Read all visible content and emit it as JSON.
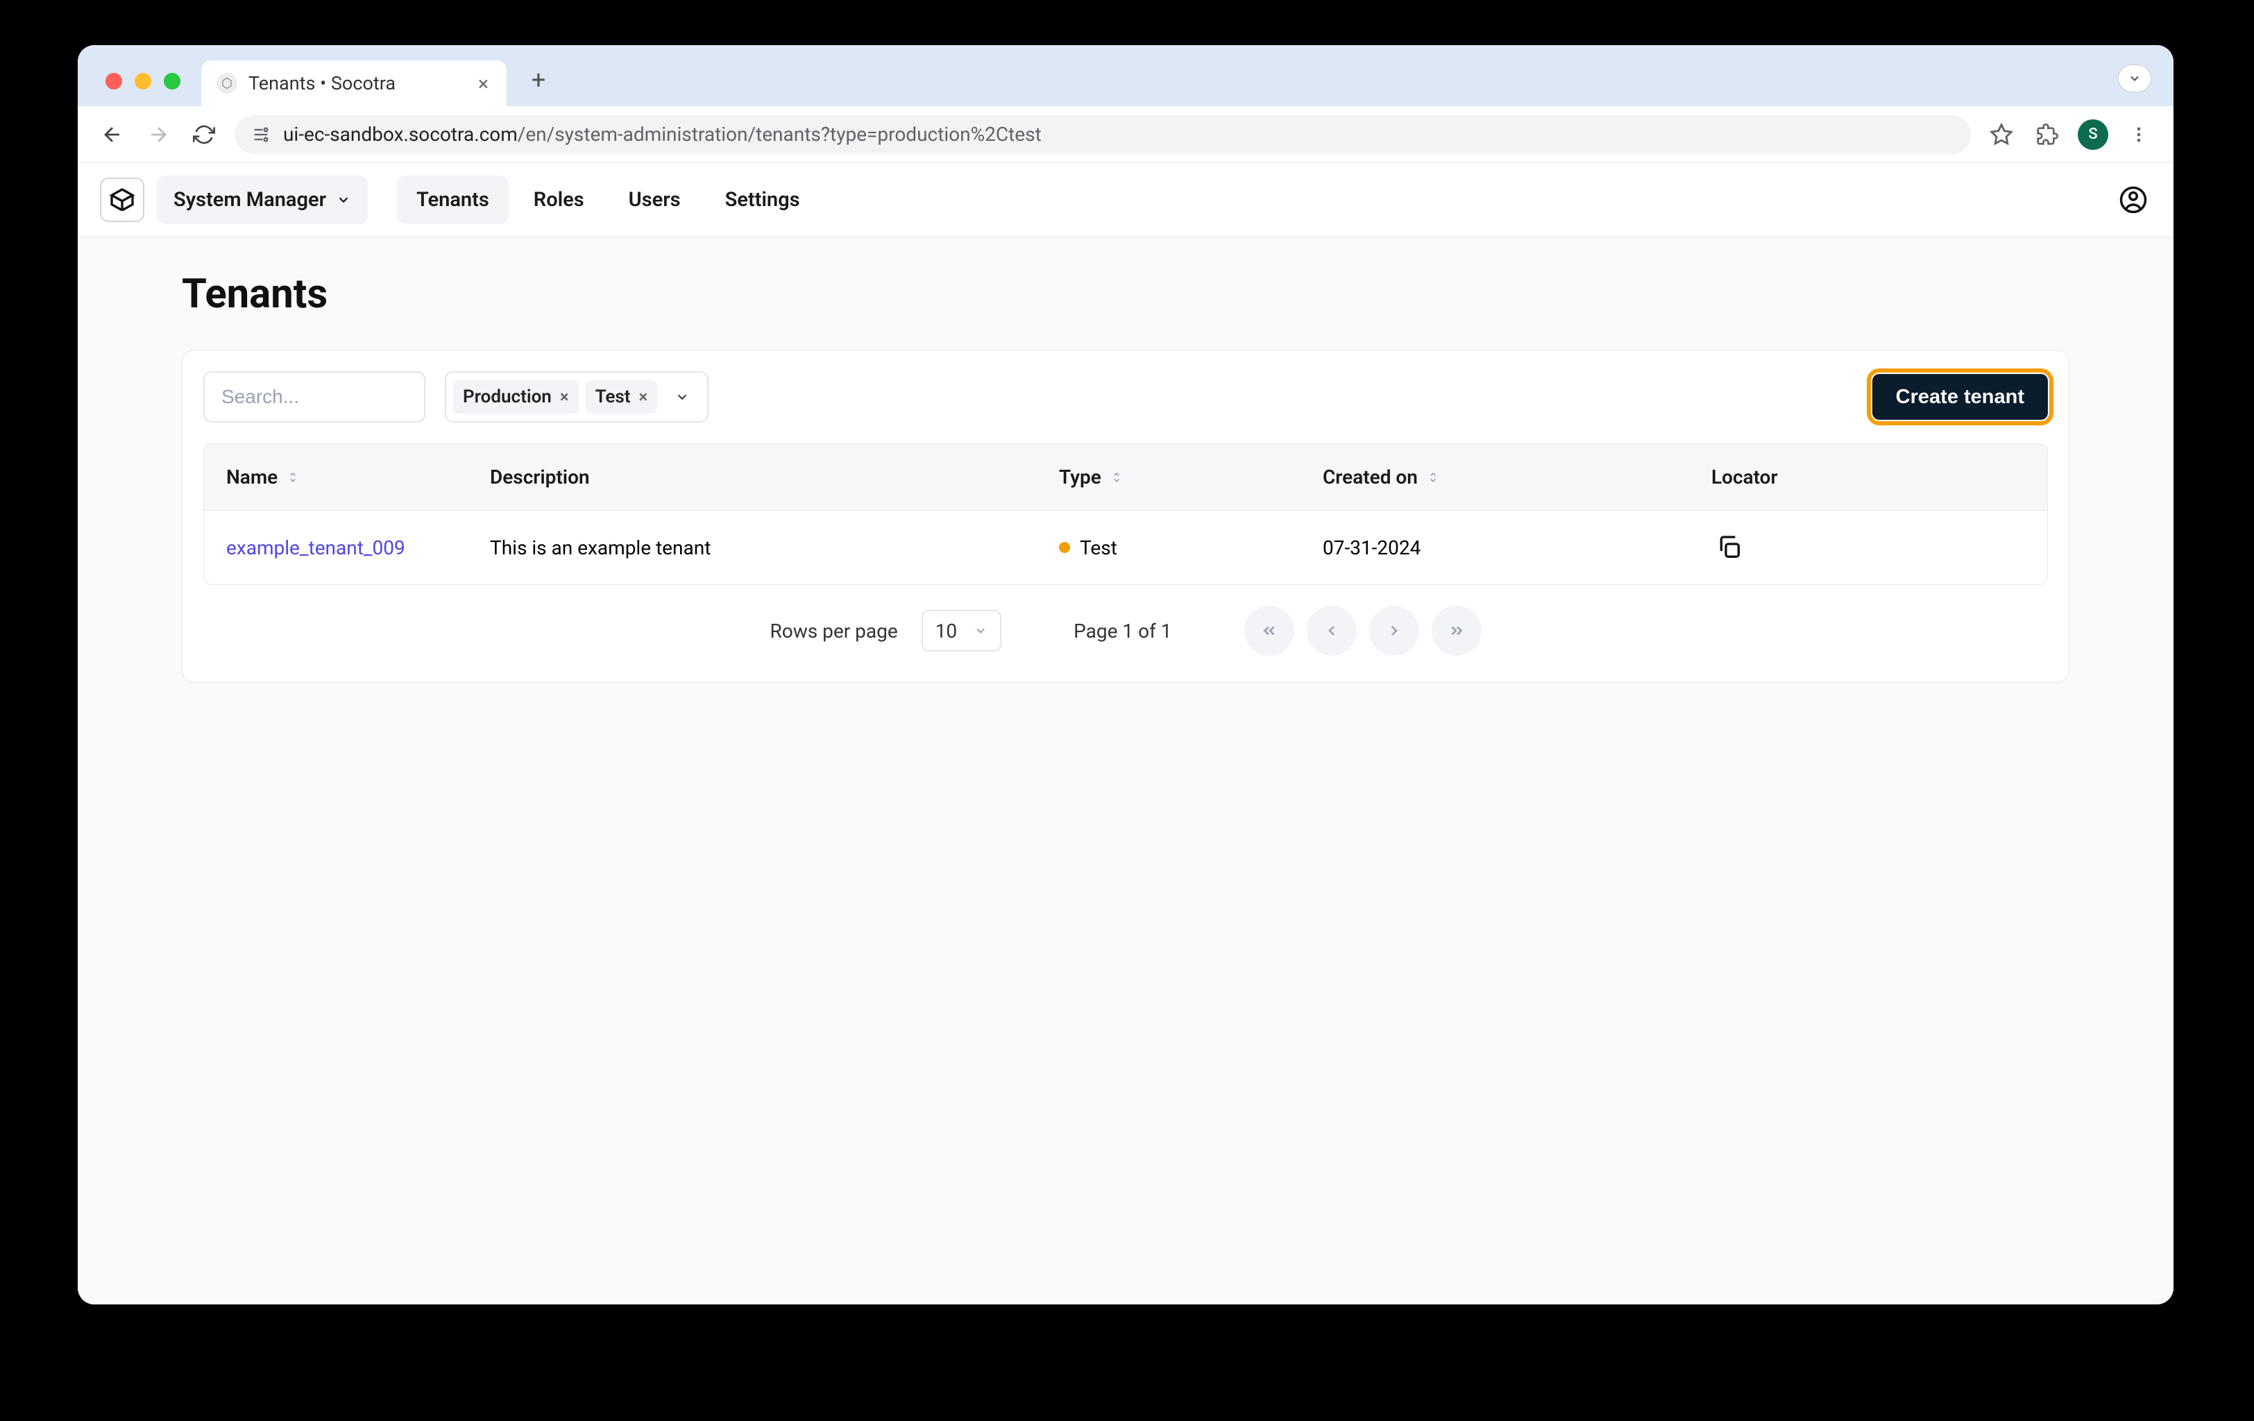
{
  "browser": {
    "tab_title": "Tenants • Socotra",
    "url_domain": "ui-ec-sandbox.socotra.com",
    "url_path": "/en/system-administration/tenants?type=production%2Ctest",
    "profile_initial": "S"
  },
  "header": {
    "switcher_label": "System Manager",
    "tabs": [
      "Tenants",
      "Roles",
      "Users",
      "Settings"
    ],
    "active_tab_index": 0
  },
  "page": {
    "title": "Tenants"
  },
  "toolbar": {
    "search_placeholder": "Search...",
    "filters": [
      {
        "label": "Production"
      },
      {
        "label": "Test"
      }
    ],
    "create_label": "Create tenant"
  },
  "table": {
    "columns": {
      "name": "Name",
      "description": "Description",
      "type": "Type",
      "created": "Created on",
      "locator": "Locator"
    },
    "rows": [
      {
        "name": "example_tenant_009",
        "description": "This is an example tenant",
        "type": "Test",
        "type_color": "#f59e0b",
        "created": "07-31-2024"
      }
    ]
  },
  "pagination": {
    "rows_label": "Rows per page",
    "rows_value": "10",
    "page_info": "Page 1 of 1"
  }
}
